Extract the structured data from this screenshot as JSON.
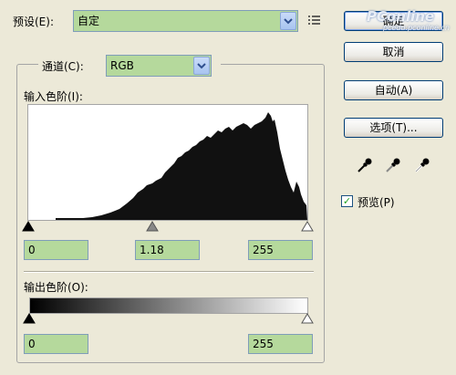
{
  "preset": {
    "label": "预设(E):",
    "value": "自定"
  },
  "buttons": {
    "ok": "确定",
    "cancel": "取消",
    "auto": "自动(A)",
    "options": "选项(T)..."
  },
  "channel": {
    "label": "通道(C):",
    "value": "RGB"
  },
  "input_levels": {
    "label": "输入色阶(I):",
    "black": "0",
    "gamma": "1.18",
    "white": "255"
  },
  "output_levels": {
    "label": "输出色阶(O):",
    "black": "0",
    "white": "255"
  },
  "preview": {
    "label": "预览(P)",
    "checked": true,
    "check_glyph": "✓"
  },
  "watermark": {
    "main": "PConline",
    "sub": "pcedu.pconline.cn"
  },
  "icons": [
    "menu-list-icon",
    "black-eyedropper-icon",
    "gray-eyedropper-icon",
    "white-eyedropper-icon"
  ],
  "colors": {
    "field_green": "#b5d99c",
    "dialog_bg": "#ece9d8",
    "xp_blue": "#003c74"
  }
}
